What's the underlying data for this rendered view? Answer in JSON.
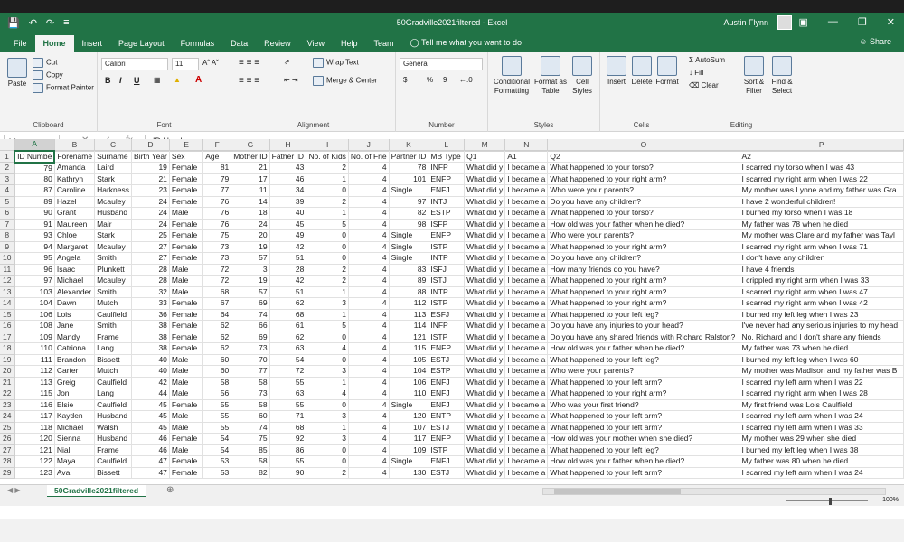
{
  "window": {
    "title": "50Gradville2021filtered  -  Excel",
    "user": "Austin Flynn",
    "share": "Share",
    "tell_me": "Tell me what you want to do"
  },
  "tabs": [
    "File",
    "Home",
    "Insert",
    "Page Layout",
    "Formulas",
    "Data",
    "Review",
    "View",
    "Help",
    "Team"
  ],
  "ribbon": {
    "clipboard": {
      "label": "Clipboard",
      "paste": "Paste",
      "cut": "Cut",
      "copy": "Copy",
      "format_painter": "Format Painter"
    },
    "font": {
      "label": "Font",
      "family": "Calibri",
      "size": "11",
      "bold": "B",
      "italic": "I",
      "underline": "U"
    },
    "alignment": {
      "label": "Alignment",
      "wrap": "Wrap Text",
      "merge": "Merge & Center"
    },
    "number": {
      "label": "Number",
      "format": "General",
      "currency": "$",
      "percent": "%",
      "comma": "9"
    },
    "styles": {
      "label": "Styles",
      "conditional": "Conditional Formatting",
      "format_table": "Format as Table",
      "cell_styles": "Cell Styles"
    },
    "cells": {
      "label": "Cells",
      "insert": "Insert",
      "delete": "Delete",
      "format": "Format"
    },
    "editing": {
      "label": "Editing",
      "autosum": "AutoSum",
      "fill": "Fill",
      "clear": "Clear",
      "sort": "Sort & Filter",
      "find": "Find & Select"
    }
  },
  "formula_bar": {
    "name_box": "A1",
    "formula": "ID Number"
  },
  "columns": [
    "A",
    "B",
    "C",
    "D",
    "E",
    "F",
    "G",
    "H",
    "I",
    "J",
    "K",
    "L",
    "M",
    "N",
    "O",
    "P"
  ],
  "header_row": [
    "ID Numbe",
    "Forename",
    "Surname",
    "Birth Year",
    "Sex",
    "Age",
    "Mother ID",
    "Father ID",
    "No. of Kids",
    "No. of Frie",
    "Partner ID",
    "MB Type",
    "Q1",
    "A1",
    "Q2",
    "A2"
  ],
  "rows": [
    [
      "79",
      "Amanda",
      "Laird",
      "19",
      "Female",
      "81",
      "21",
      "43",
      "2",
      "4",
      "78",
      "INFP",
      "What did y",
      "I became a",
      "What happened to your torso?",
      "I scarred my torso when I was 43"
    ],
    [
      "80",
      "Kathryn",
      "Stark",
      "21",
      "Female",
      "79",
      "17",
      "46",
      "1",
      "4",
      "101",
      "ENFP",
      "What did y",
      "I became a",
      "What happened to your right arm?",
      "I scarred my right arm when I was 22"
    ],
    [
      "87",
      "Caroline",
      "Harkness",
      "23",
      "Female",
      "77",
      "11",
      "34",
      "0",
      "4",
      "Single",
      "ENFJ",
      "What did y",
      "I became a",
      "Who were your parents?",
      "My mother was Lynne and my father was Gra"
    ],
    [
      "89",
      "Hazel",
      "Mcauley",
      "24",
      "Female",
      "76",
      "14",
      "39",
      "2",
      "4",
      "97",
      "INTJ",
      "What did y",
      "I became a",
      "Do you have any children?",
      "I have 2 wonderful children!"
    ],
    [
      "90",
      "Grant",
      "Husband",
      "24",
      "Male",
      "76",
      "18",
      "40",
      "1",
      "4",
      "82",
      "ESTP",
      "What did y",
      "I became a",
      "What happened to your torso?",
      "I burned my torso when I was 18"
    ],
    [
      "91",
      "Maureen",
      "Mair",
      "24",
      "Female",
      "76",
      "24",
      "45",
      "5",
      "4",
      "98",
      "ISFP",
      "What did y",
      "I became a",
      "How old was your father when he died?",
      "My father was 78 when he died"
    ],
    [
      "93",
      "Chloe",
      "Stark",
      "25",
      "Female",
      "75",
      "20",
      "49",
      "0",
      "4",
      "Single",
      "ENFP",
      "What did y",
      "I became a",
      "Who were your parents?",
      "My mother was Clare and my father was Tayl"
    ],
    [
      "94",
      "Margaret",
      "Mcauley",
      "27",
      "Female",
      "73",
      "19",
      "42",
      "0",
      "4",
      "Single",
      "ISTP",
      "What did y",
      "I became a",
      "What happened to your right arm?",
      "I scarred my right arm when I was 71"
    ],
    [
      "95",
      "Angela",
      "Smith",
      "27",
      "Female",
      "73",
      "57",
      "51",
      "0",
      "4",
      "Single",
      "INTP",
      "What did y",
      "I became a",
      "Do you have any children?",
      "I don't have any children"
    ],
    [
      "96",
      "Isaac",
      "Plunkett",
      "28",
      "Male",
      "72",
      "3",
      "28",
      "2",
      "4",
      "83",
      "ISFJ",
      "What did y",
      "I became a",
      "How many friends do you have?",
      "I have 4 friends"
    ],
    [
      "97",
      "Michael",
      "Mcauley",
      "28",
      "Male",
      "72",
      "19",
      "42",
      "2",
      "4",
      "89",
      "ISTJ",
      "What did y",
      "I became a",
      "What happened to your right arm?",
      "I crippled my right arm when I was 33"
    ],
    [
      "103",
      "Alexander",
      "Smith",
      "32",
      "Male",
      "68",
      "57",
      "51",
      "1",
      "4",
      "88",
      "INTP",
      "What did y",
      "I became a",
      "What happened to your right arm?",
      "I scarred my right arm when I was 47"
    ],
    [
      "104",
      "Dawn",
      "Mutch",
      "33",
      "Female",
      "67",
      "69",
      "62",
      "3",
      "4",
      "112",
      "ISTP",
      "What did y",
      "I became a",
      "What happened to your right arm?",
      "I scarred my right arm when I was 42"
    ],
    [
      "106",
      "Lois",
      "Caulfield",
      "36",
      "Female",
      "64",
      "74",
      "68",
      "1",
      "4",
      "113",
      "ESFJ",
      "What did y",
      "I became a",
      "What happened to your left leg?",
      "I burned my left leg when I was 23"
    ],
    [
      "108",
      "Jane",
      "Smith",
      "38",
      "Female",
      "62",
      "66",
      "61",
      "5",
      "4",
      "114",
      "INFP",
      "What did y",
      "I became a",
      "Do you have any injuries to your head?",
      "I've never had any serious injuries to my head"
    ],
    [
      "109",
      "Mandy",
      "Frame",
      "38",
      "Female",
      "62",
      "69",
      "62",
      "0",
      "4",
      "121",
      "ISTP",
      "What did y",
      "I became a",
      "Do you have any shared friends with Richard Ralston?",
      "No. Richard and I don't share any friends"
    ],
    [
      "110",
      "Catriona",
      "Lang",
      "38",
      "Female",
      "62",
      "73",
      "63",
      "4",
      "4",
      "115",
      "ENFP",
      "What did y",
      "I became a",
      "How old was your father when he died?",
      "My father was 73 when he died"
    ],
    [
      "111",
      "Brandon",
      "Bissett",
      "40",
      "Male",
      "60",
      "70",
      "54",
      "0",
      "4",
      "105",
      "ESTJ",
      "What did y",
      "I became a",
      "What happened to your left leg?",
      "I burned my left leg when I was 60"
    ],
    [
      "112",
      "Carter",
      "Mutch",
      "40",
      "Male",
      "60",
      "77",
      "72",
      "3",
      "4",
      "104",
      "ESTP",
      "What did y",
      "I became a",
      "Who were your parents?",
      "My mother was Madison and my father was B"
    ],
    [
      "113",
      "Greig",
      "Caulfield",
      "42",
      "Male",
      "58",
      "58",
      "55",
      "1",
      "4",
      "106",
      "ENFJ",
      "What did y",
      "I became a",
      "What happened to your left arm?",
      "I scarred my left arm when I was 22"
    ],
    [
      "115",
      "Jon",
      "Lang",
      "44",
      "Male",
      "56",
      "73",
      "63",
      "4",
      "4",
      "110",
      "ENFJ",
      "What did y",
      "I became a",
      "What happened to your right arm?",
      "I scarred my right arm when I was 28"
    ],
    [
      "116",
      "Elsie",
      "Caulfield",
      "45",
      "Female",
      "55",
      "58",
      "55",
      "0",
      "4",
      "Single",
      "ENFJ",
      "What did y",
      "I became a",
      "Who was your first friend?",
      "My first friend was Lois Caulfield"
    ],
    [
      "117",
      "Kayden",
      "Husband",
      "45",
      "Male",
      "55",
      "60",
      "71",
      "3",
      "4",
      "120",
      "ENTP",
      "What did y",
      "I became a",
      "What happened to your left arm?",
      "I scarred my left arm when I was 24"
    ],
    [
      "118",
      "Michael",
      "Walsh",
      "45",
      "Male",
      "55",
      "74",
      "68",
      "1",
      "4",
      "107",
      "ESTJ",
      "What did y",
      "I became a",
      "What happened to your left arm?",
      "I scarred my left arm when I was 33"
    ],
    [
      "120",
      "Sienna",
      "Husband",
      "46",
      "Female",
      "54",
      "75",
      "92",
      "3",
      "4",
      "117",
      "ENFP",
      "What did y",
      "I became a",
      "How old was your mother when she died?",
      "My mother was 29 when she died"
    ],
    [
      "121",
      "Niall",
      "Frame",
      "46",
      "Male",
      "54",
      "85",
      "86",
      "0",
      "4",
      "109",
      "ISTP",
      "What did y",
      "I became a",
      "What happened to your left leg?",
      "I burned my left leg when I was 38"
    ],
    [
      "122",
      "Maya",
      "Caulfield",
      "47",
      "Female",
      "53",
      "58",
      "55",
      "0",
      "4",
      "Single",
      "ENFJ",
      "What did y",
      "I became a",
      "How old was your father when he died?",
      "My father was 80 when he died"
    ],
    [
      "123",
      "Ava",
      "Bissett",
      "47",
      "Female",
      "53",
      "82",
      "90",
      "2",
      "4",
      "130",
      "ESTJ",
      "What did y",
      "I became a",
      "What happened to your left arm?",
      "I scarred my left arm when I was 24"
    ]
  ],
  "sheet_tab": "50Gradville2021filtered",
  "zoom": "100%"
}
